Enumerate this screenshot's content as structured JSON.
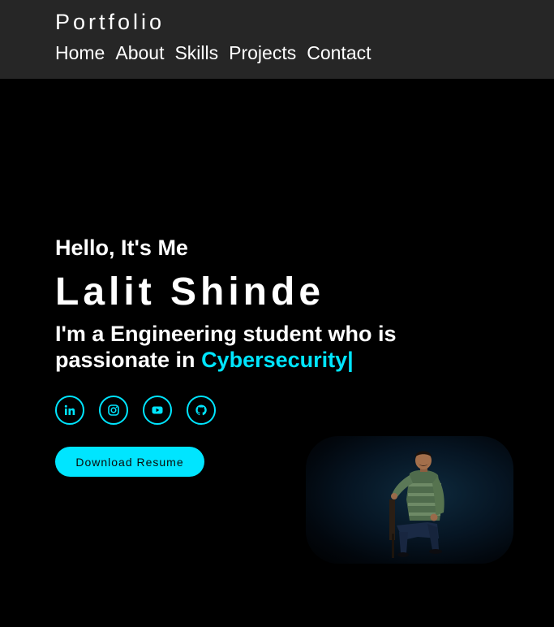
{
  "header": {
    "logo": "Portfolio",
    "nav": [
      {
        "label": "Home"
      },
      {
        "label": "About"
      },
      {
        "label": "Skills"
      },
      {
        "label": "Projects"
      },
      {
        "label": "Contact"
      }
    ]
  },
  "hero": {
    "greeting": "Hello, It's Me",
    "name": "Lalit Shinde",
    "tagline_prefix": "I'm a Engineering student who is passionate in ",
    "tagline_highlight": "Cybersecurity|",
    "socials": [
      {
        "icon": "linkedin-icon"
      },
      {
        "icon": "instagram-icon"
      },
      {
        "icon": "youtube-icon"
      },
      {
        "icon": "github-icon"
      }
    ],
    "resume_label": "Download Resume"
  },
  "colors": {
    "accent": "#00e5ff",
    "header_bg": "#262626",
    "page_bg": "#000000"
  }
}
